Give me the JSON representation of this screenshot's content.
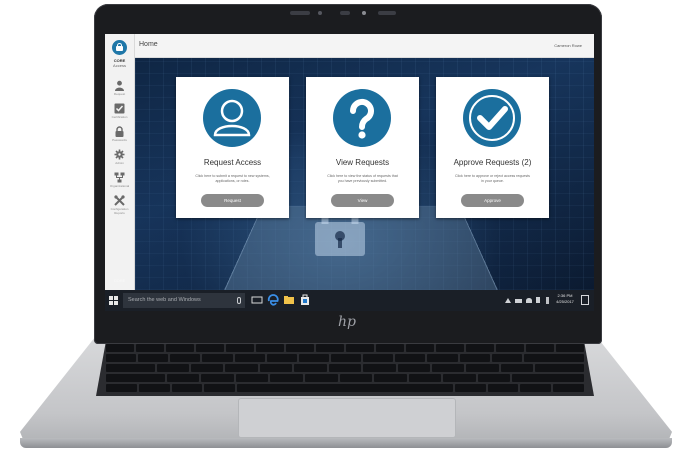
{
  "app": {
    "brand": "CORE",
    "brand_sub": "Access",
    "page_title": "Home",
    "user_name": "Cameron Rowe",
    "footer_logo": "CORE"
  },
  "sidebar": {
    "items": [
      {
        "label": "Request",
        "icon": "user-icon"
      },
      {
        "label": "Certification",
        "icon": "checkbox-icon"
      },
      {
        "label": "Passwords",
        "icon": "lock-icon"
      },
      {
        "label": "Admin",
        "icon": "gear-icon"
      },
      {
        "label": "Organizational",
        "icon": "hierarchy-icon"
      },
      {
        "label": "Configuration Reports",
        "icon": "tools-icon"
      }
    ]
  },
  "cards": [
    {
      "title": "Request Access",
      "description": "Click here to submit a request to new systems, applications, or roles.",
      "button": "Request",
      "icon": "user-icon"
    },
    {
      "title": "View Requests",
      "description": "Click here to view the status of requests that you have previously submitted.",
      "button": "View",
      "icon": "question-mark-icon"
    },
    {
      "title": "Approve Requests (2)",
      "description": "Click here to approve or reject access requests in your queue.",
      "button": "Approve",
      "icon": "checkmark-icon"
    }
  ],
  "taskbar": {
    "search_placeholder": "Search the web and Windows",
    "time": "2:36 PM",
    "date": "4/25/2017"
  },
  "device": {
    "logo": "hp"
  },
  "colors": {
    "accent": "#1b6f9e",
    "button": "#8a8a8a",
    "taskbar": "#1a1f27"
  }
}
